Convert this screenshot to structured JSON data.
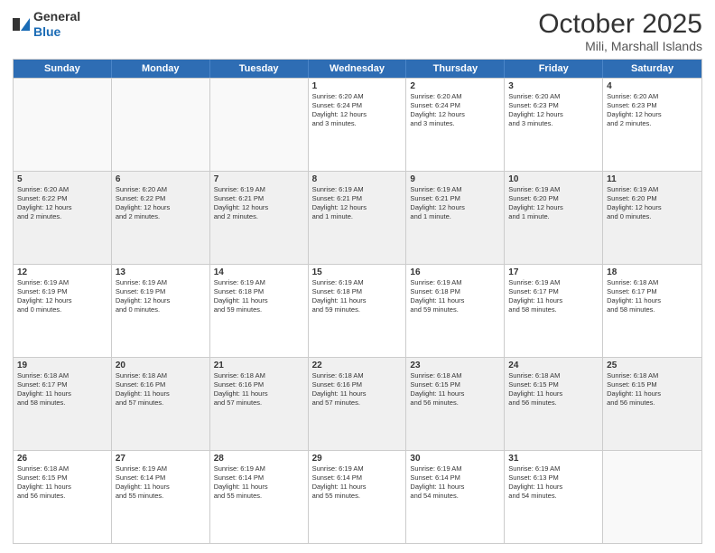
{
  "header": {
    "logo_general": "General",
    "logo_blue": "Blue",
    "title": "October 2025",
    "subtitle": "Mili, Marshall Islands"
  },
  "calendar": {
    "days": [
      "Sunday",
      "Monday",
      "Tuesday",
      "Wednesday",
      "Thursday",
      "Friday",
      "Saturday"
    ],
    "rows": [
      [
        {
          "day": "",
          "info": ""
        },
        {
          "day": "",
          "info": ""
        },
        {
          "day": "",
          "info": ""
        },
        {
          "day": "1",
          "info": "Sunrise: 6:20 AM\nSunset: 6:24 PM\nDaylight: 12 hours\nand 3 minutes."
        },
        {
          "day": "2",
          "info": "Sunrise: 6:20 AM\nSunset: 6:24 PM\nDaylight: 12 hours\nand 3 minutes."
        },
        {
          "day": "3",
          "info": "Sunrise: 6:20 AM\nSunset: 6:23 PM\nDaylight: 12 hours\nand 3 minutes."
        },
        {
          "day": "4",
          "info": "Sunrise: 6:20 AM\nSunset: 6:23 PM\nDaylight: 12 hours\nand 2 minutes."
        }
      ],
      [
        {
          "day": "5",
          "info": "Sunrise: 6:20 AM\nSunset: 6:22 PM\nDaylight: 12 hours\nand 2 minutes."
        },
        {
          "day": "6",
          "info": "Sunrise: 6:20 AM\nSunset: 6:22 PM\nDaylight: 12 hours\nand 2 minutes."
        },
        {
          "day": "7",
          "info": "Sunrise: 6:19 AM\nSunset: 6:21 PM\nDaylight: 12 hours\nand 2 minutes."
        },
        {
          "day": "8",
          "info": "Sunrise: 6:19 AM\nSunset: 6:21 PM\nDaylight: 12 hours\nand 1 minute."
        },
        {
          "day": "9",
          "info": "Sunrise: 6:19 AM\nSunset: 6:21 PM\nDaylight: 12 hours\nand 1 minute."
        },
        {
          "day": "10",
          "info": "Sunrise: 6:19 AM\nSunset: 6:20 PM\nDaylight: 12 hours\nand 1 minute."
        },
        {
          "day": "11",
          "info": "Sunrise: 6:19 AM\nSunset: 6:20 PM\nDaylight: 12 hours\nand 0 minutes."
        }
      ],
      [
        {
          "day": "12",
          "info": "Sunrise: 6:19 AM\nSunset: 6:19 PM\nDaylight: 12 hours\nand 0 minutes."
        },
        {
          "day": "13",
          "info": "Sunrise: 6:19 AM\nSunset: 6:19 PM\nDaylight: 12 hours\nand 0 minutes."
        },
        {
          "day": "14",
          "info": "Sunrise: 6:19 AM\nSunset: 6:18 PM\nDaylight: 11 hours\nand 59 minutes."
        },
        {
          "day": "15",
          "info": "Sunrise: 6:19 AM\nSunset: 6:18 PM\nDaylight: 11 hours\nand 59 minutes."
        },
        {
          "day": "16",
          "info": "Sunrise: 6:19 AM\nSunset: 6:18 PM\nDaylight: 11 hours\nand 59 minutes."
        },
        {
          "day": "17",
          "info": "Sunrise: 6:19 AM\nSunset: 6:17 PM\nDaylight: 11 hours\nand 58 minutes."
        },
        {
          "day": "18",
          "info": "Sunrise: 6:18 AM\nSunset: 6:17 PM\nDaylight: 11 hours\nand 58 minutes."
        }
      ],
      [
        {
          "day": "19",
          "info": "Sunrise: 6:18 AM\nSunset: 6:17 PM\nDaylight: 11 hours\nand 58 minutes."
        },
        {
          "day": "20",
          "info": "Sunrise: 6:18 AM\nSunset: 6:16 PM\nDaylight: 11 hours\nand 57 minutes."
        },
        {
          "day": "21",
          "info": "Sunrise: 6:18 AM\nSunset: 6:16 PM\nDaylight: 11 hours\nand 57 minutes."
        },
        {
          "day": "22",
          "info": "Sunrise: 6:18 AM\nSunset: 6:16 PM\nDaylight: 11 hours\nand 57 minutes."
        },
        {
          "day": "23",
          "info": "Sunrise: 6:18 AM\nSunset: 6:15 PM\nDaylight: 11 hours\nand 56 minutes."
        },
        {
          "day": "24",
          "info": "Sunrise: 6:18 AM\nSunset: 6:15 PM\nDaylight: 11 hours\nand 56 minutes."
        },
        {
          "day": "25",
          "info": "Sunrise: 6:18 AM\nSunset: 6:15 PM\nDaylight: 11 hours\nand 56 minutes."
        }
      ],
      [
        {
          "day": "26",
          "info": "Sunrise: 6:18 AM\nSunset: 6:15 PM\nDaylight: 11 hours\nand 56 minutes."
        },
        {
          "day": "27",
          "info": "Sunrise: 6:19 AM\nSunset: 6:14 PM\nDaylight: 11 hours\nand 55 minutes."
        },
        {
          "day": "28",
          "info": "Sunrise: 6:19 AM\nSunset: 6:14 PM\nDaylight: 11 hours\nand 55 minutes."
        },
        {
          "day": "29",
          "info": "Sunrise: 6:19 AM\nSunset: 6:14 PM\nDaylight: 11 hours\nand 55 minutes."
        },
        {
          "day": "30",
          "info": "Sunrise: 6:19 AM\nSunset: 6:14 PM\nDaylight: 11 hours\nand 54 minutes."
        },
        {
          "day": "31",
          "info": "Sunrise: 6:19 AM\nSunset: 6:13 PM\nDaylight: 11 hours\nand 54 minutes."
        },
        {
          "day": "",
          "info": ""
        }
      ]
    ]
  }
}
